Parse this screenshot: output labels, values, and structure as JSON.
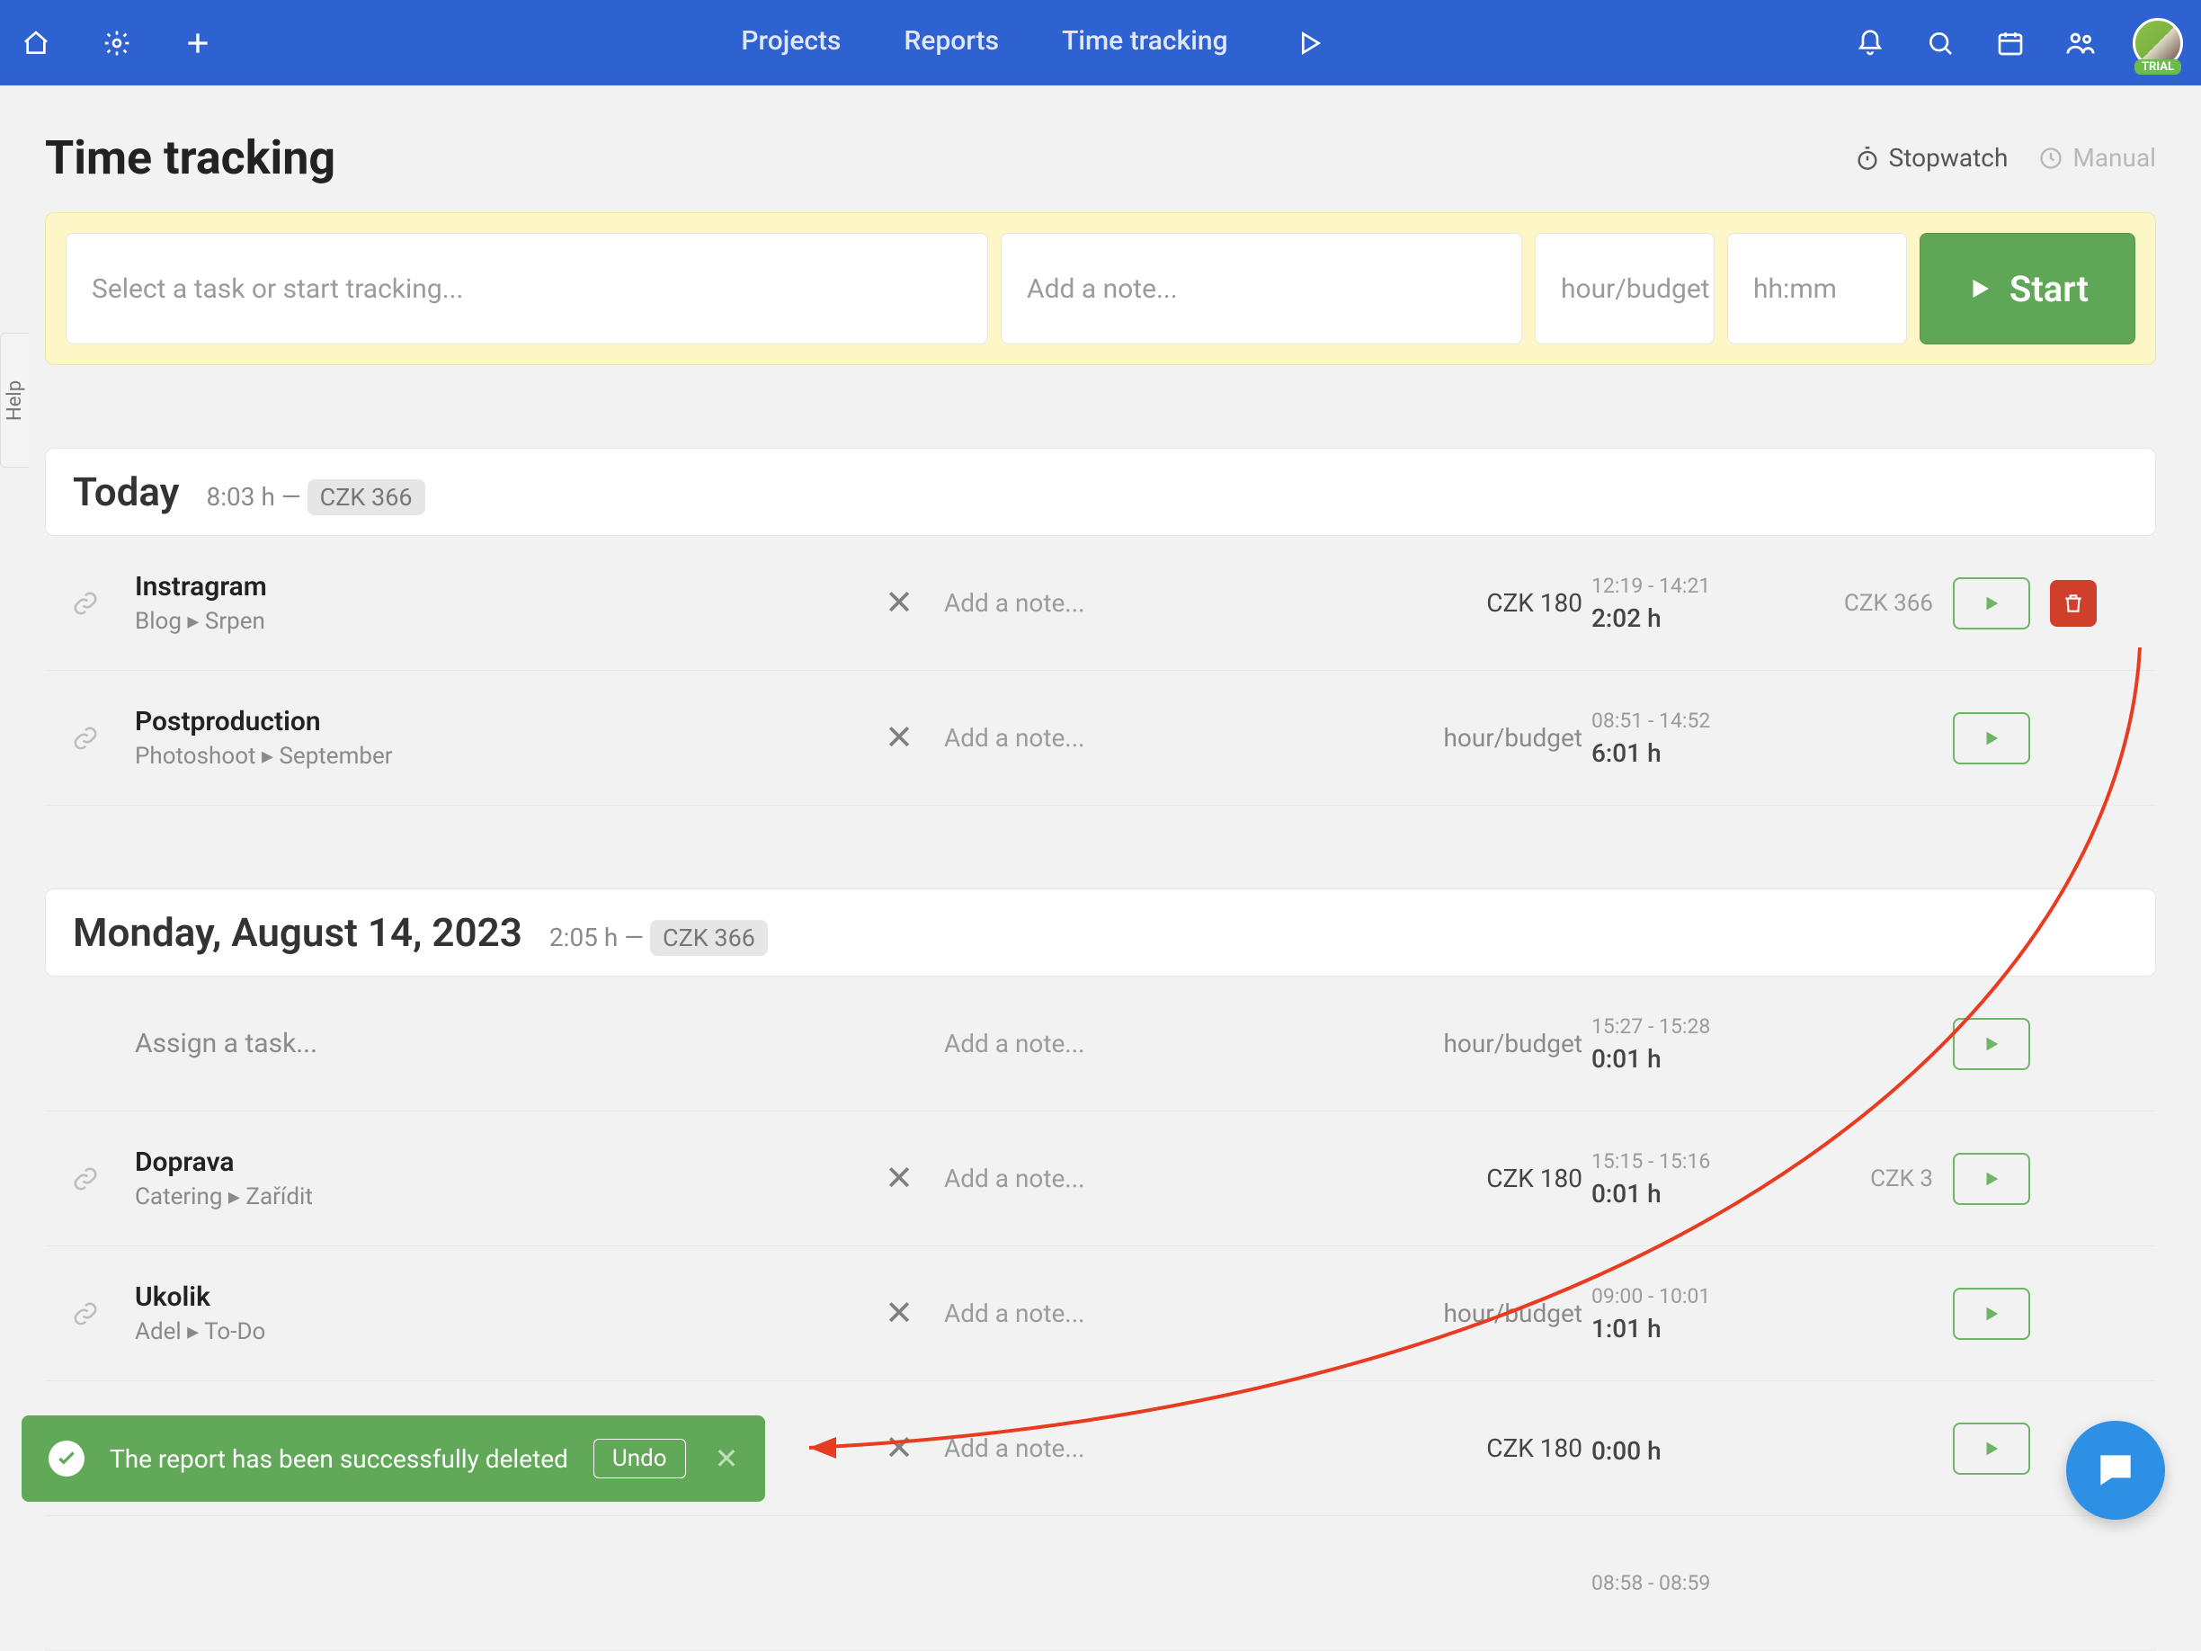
{
  "nav": {
    "projects": "Projects",
    "reports": "Reports",
    "time_tracking": "Time tracking"
  },
  "trial_badge": "TRIAL",
  "page_title": "Time tracking",
  "mode": {
    "stopwatch": "Stopwatch",
    "manual": "Manual"
  },
  "tracker": {
    "task_placeholder": "Select a task or start tracking...",
    "note_placeholder": "Add a note...",
    "rate_placeholder": "hour/budget",
    "time_placeholder": "hh:mm",
    "start_label": "Start"
  },
  "help_label": "Help",
  "days": [
    {
      "title": "Today",
      "meta_hours": "8:03 h —",
      "meta_badge": "CZK 366",
      "entries": [
        {
          "link": true,
          "task": "Instragram",
          "path": "Blog ▸ Srpen",
          "has_x": true,
          "note": "Add a note...",
          "rate": "CZK 180",
          "rate_style": "dark",
          "range": "12:19 - 14:21",
          "duration": "2:02 h",
          "total": "CZK 366",
          "delete": true
        },
        {
          "link": true,
          "task": "Postproduction",
          "path": "Photoshoot ▸ September",
          "has_x": true,
          "note": "Add a note...",
          "rate": "hour/budget",
          "rate_style": "dim",
          "range": "08:51 - 14:52",
          "duration": "6:01 h",
          "total": "",
          "delete": false
        }
      ]
    },
    {
      "title": "Monday, August 14, 2023",
      "meta_hours": "2:05 h —",
      "meta_badge": "CZK 366",
      "entries": [
        {
          "link": false,
          "task": "Assign a task...",
          "task_placeholder": true,
          "path": "",
          "has_x": false,
          "note": "Add a note...",
          "rate": "hour/budget",
          "rate_style": "dim",
          "range": "15:27 - 15:28",
          "duration": "0:01 h",
          "total": "",
          "delete": false
        },
        {
          "link": true,
          "task": "Doprava",
          "path": "Catering ▸ Zařídit",
          "has_x": true,
          "note": "Add a note...",
          "rate": "CZK 180",
          "rate_style": "dark",
          "range": "15:15 - 15:16",
          "duration": "0:01 h",
          "total": "CZK 3",
          "delete": false
        },
        {
          "link": true,
          "task": "Ukolik",
          "path": "Adel ▸ To-Do",
          "has_x": true,
          "note": "Add a note...",
          "rate": "hour/budget",
          "rate_style": "dim",
          "range": "09:00 - 10:01",
          "duration": "1:01 h",
          "total": "",
          "delete": false
        },
        {
          "link": false,
          "task": "",
          "path": "",
          "has_x": true,
          "note": "Add a note...",
          "rate": "CZK 180",
          "rate_style": "dark",
          "range": "",
          "duration": "0:00 h",
          "total": "",
          "delete": false
        },
        {
          "link": false,
          "task": "",
          "path": "",
          "has_x": false,
          "note": "",
          "rate": "",
          "rate_style": "dim",
          "range": "08:58 - 08:59",
          "duration": "",
          "total": "",
          "delete": false
        }
      ]
    }
  ],
  "toast": {
    "message": "The report has been successfully deleted",
    "undo": "Undo"
  }
}
